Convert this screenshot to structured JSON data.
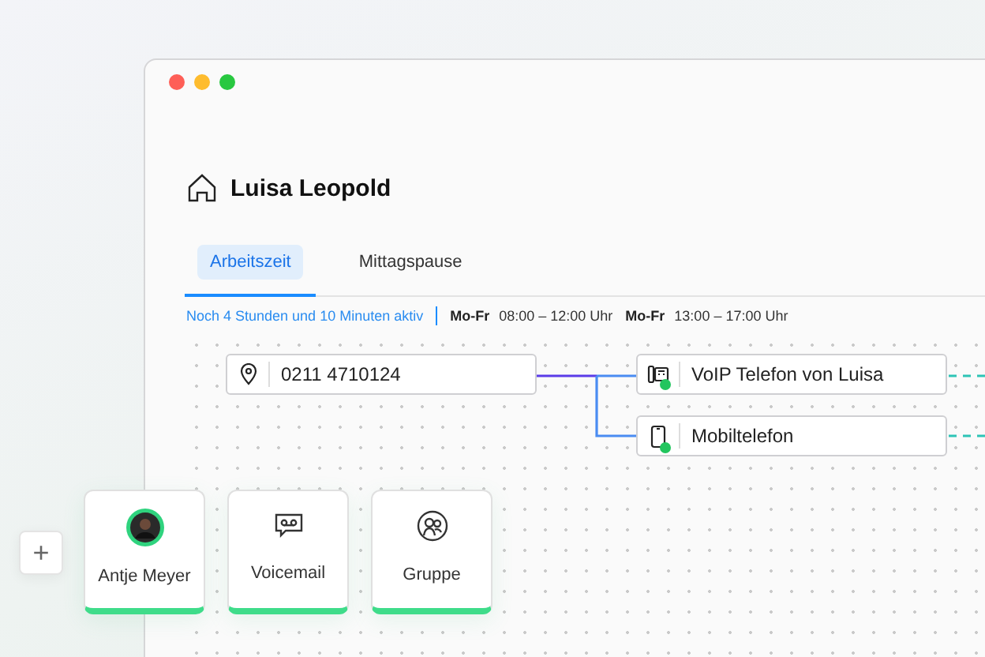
{
  "contact": {
    "name": "Luisa Leopold"
  },
  "tabs": [
    {
      "label": "Arbeitszeit",
      "selected": true
    },
    {
      "label": "Mittagspause",
      "selected": false
    }
  ],
  "schedule": {
    "status": "Noch 4 Stunden und 10 Minuten aktiv",
    "slots": [
      {
        "days": "Mo-Fr",
        "time": "08:00 – 12:00 Uhr"
      },
      {
        "days": "Mo-Fr",
        "time": "13:00 – 17:00 Uhr"
      }
    ]
  },
  "source": {
    "number": "0211 4710124"
  },
  "devices": [
    {
      "kind": "voip",
      "label": "VoIP Telefon von Luisa",
      "online": true
    },
    {
      "kind": "mobile",
      "label": "Mobiltelefon",
      "online": true
    }
  ],
  "targets": [
    {
      "kind": "person",
      "label": "Antje Meyer"
    },
    {
      "kind": "voicemail",
      "label": "Voicemail"
    },
    {
      "kind": "group",
      "label": "Gruppe"
    }
  ],
  "add_button": {
    "label": "+"
  }
}
